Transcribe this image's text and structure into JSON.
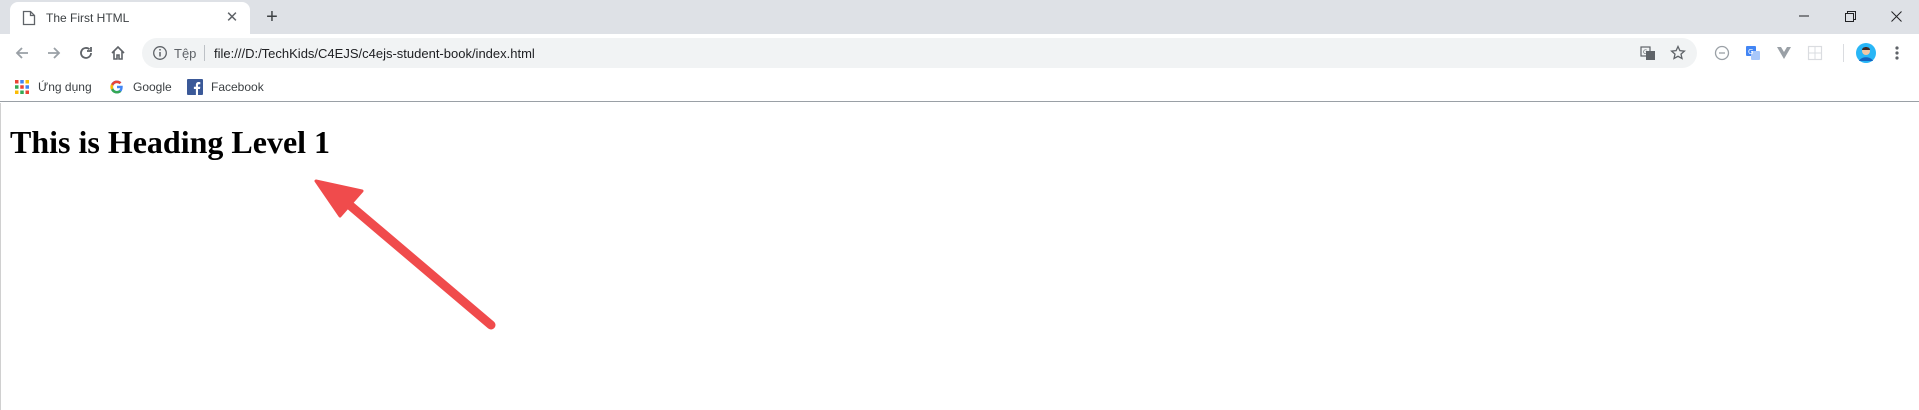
{
  "browser": {
    "tab": {
      "title": "The First HTML",
      "close_glyph": "✕"
    },
    "new_tab_glyph": "+",
    "window_controls": {
      "minimize": "minimize-icon",
      "restore": "restore-icon",
      "close": "close-icon"
    },
    "address_bar": {
      "site_info_label": "Tệp",
      "url": "file:///D:/TechKids/C4EJS/c4ejs-student-book/index.html"
    },
    "bookmarks": [
      {
        "label": "Ứng dụng",
        "icon": "apps-grid-icon"
      },
      {
        "label": "Google",
        "icon": "google-g-icon"
      },
      {
        "label": "Facebook",
        "icon": "facebook-icon"
      }
    ],
    "colors": {
      "tabstrip": "#dee1e6",
      "omnibox": "#f1f3f4",
      "annotation_arrow": "#f04b4c",
      "facebook": "#3b5998"
    }
  },
  "page": {
    "heading": "This is Heading Level 1"
  }
}
